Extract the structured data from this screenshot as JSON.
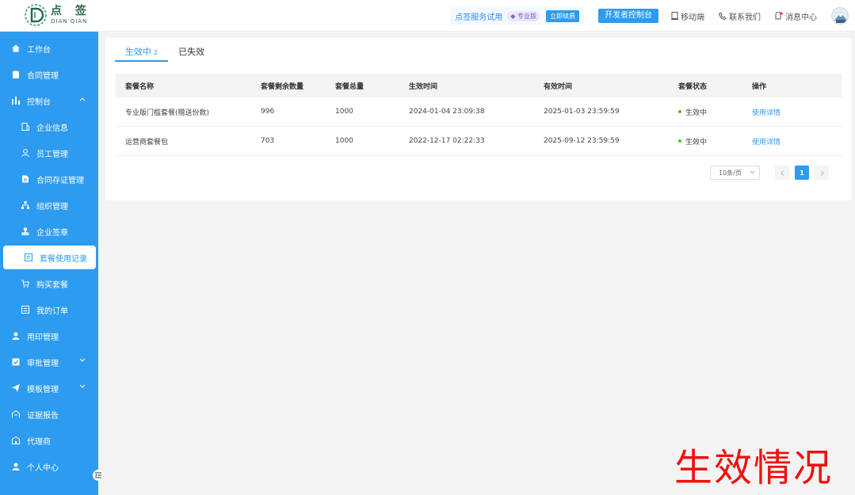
{
  "header": {
    "logo_cn": "点 签",
    "logo_en": "DIAN QIAN",
    "service_label": "点签服务试用",
    "service_badge": "专业版",
    "renew_label": "立即续费",
    "dev_console_label": "开发者控制台",
    "links": [
      {
        "label": "移动端",
        "icon": "mobile-icon"
      },
      {
        "label": "联系我们",
        "icon": "phone-icon"
      },
      {
        "label": "消息中心",
        "icon": "bell-icon"
      }
    ]
  },
  "sidebar": {
    "items": [
      {
        "label": "工作台",
        "icon": "home-icon"
      },
      {
        "label": "合同管理",
        "icon": "clipboard-icon"
      },
      {
        "label": "控制台",
        "icon": "bar-chart-icon"
      },
      {
        "label": "企业信息",
        "icon": "building-icon"
      },
      {
        "label": "员工管理",
        "icon": "user-icon"
      },
      {
        "label": "合同存证管理",
        "icon": "document-icon"
      },
      {
        "label": "组织管理",
        "icon": "org-icon"
      },
      {
        "label": "企业签章",
        "icon": "stamp-icon"
      },
      {
        "label": "套餐使用记录",
        "icon": "record-icon"
      },
      {
        "label": "购买套餐",
        "icon": "cart-icon"
      },
      {
        "label": "我的订单",
        "icon": "order-icon"
      },
      {
        "label": "用印管理",
        "icon": "seal-user-icon"
      },
      {
        "label": "审批管理",
        "icon": "approve-icon"
      },
      {
        "label": "模板管理",
        "icon": "send-icon"
      },
      {
        "label": "证据报告",
        "icon": "report-icon"
      },
      {
        "label": "代理商",
        "icon": "agent-icon"
      },
      {
        "label": "个人中心",
        "icon": "person-icon"
      }
    ]
  },
  "tabs": [
    {
      "label": "生效中",
      "count": "2"
    },
    {
      "label": "已失效",
      "count": ""
    }
  ],
  "table": {
    "headers": [
      "套餐名称",
      "套餐剩余数量",
      "套餐总量",
      "生效时间",
      "有效时间",
      "套餐状态",
      "操作"
    ],
    "rows": [
      {
        "name": "专业版门槛套餐(赠送份数)",
        "remaining": "996",
        "total": "1000",
        "start": "2024-01-04 23:09:38",
        "end": "2025-01-03 23:59:59",
        "status": "生效中",
        "action": "使用详情"
      },
      {
        "name": "运营商套餐包",
        "remaining": "703",
        "total": "1000",
        "start": "2022-12-17 02:22:33",
        "end": "2025-09-12 23:59:59",
        "status": "生效中",
        "action": "使用详情"
      }
    ]
  },
  "pagination": {
    "page_size": "10条/页",
    "current_page": "1"
  },
  "watermark": "生效情况",
  "colors": {
    "accent": "#2d9bf0",
    "status_ok": "#52c41a",
    "watermark": "#ee1111"
  }
}
